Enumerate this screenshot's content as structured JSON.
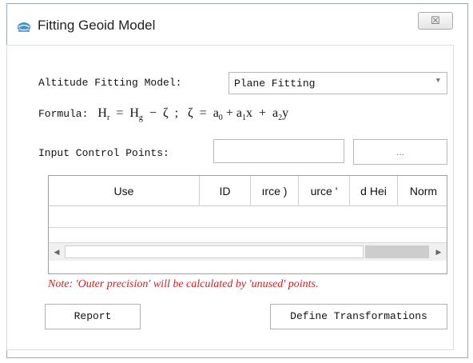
{
  "window": {
    "title": "Fitting Geoid Model",
    "close_glyph": "☒",
    "app_icon": "globe-icon"
  },
  "altitude": {
    "label": "Altitude Fitting Model:",
    "selected": "Plane Fitting"
  },
  "formula": {
    "label": "Formula:",
    "H": "H",
    "sub_r": "r",
    "equals": "=",
    "sub_g": "g",
    "minus": "−",
    "zeta": "ζ",
    "sep": ";",
    "a0": "a",
    "sub_0": "0",
    "plus": "+",
    "a1": "a",
    "sub_1": "1",
    "x": "x",
    "a2": "a",
    "sub_2": "2",
    "y": "y"
  },
  "control_points": {
    "label": "Input Control Points:",
    "value": "",
    "browse_label": "..."
  },
  "table": {
    "columns": [
      "Use",
      "ID",
      "ırce )",
      "urce '",
      "d Hei",
      "Norm"
    ]
  },
  "note": "Note: 'Outer precision' will be calculated by 'unused' points.",
  "buttons": {
    "report": "Report",
    "define": "Define Transformations"
  }
}
